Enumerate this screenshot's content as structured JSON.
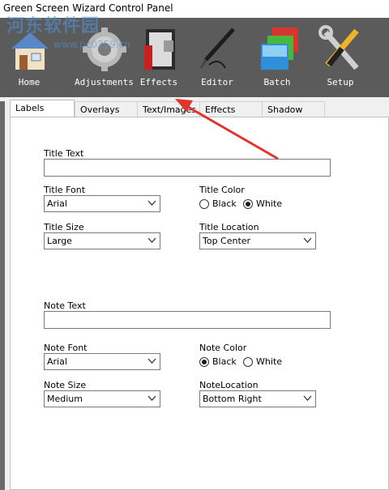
{
  "window": {
    "title": "Green Screen Wizard Control Panel"
  },
  "watermark": {
    "text": "河东软件园",
    "url": "www.pc0359.cn"
  },
  "toolbar": {
    "items": [
      {
        "label": "Home",
        "icon": "home-icon"
      },
      {
        "label": "Adjustments",
        "icon": "gear-icon"
      },
      {
        "label": "Effects",
        "icon": "effects-icon"
      },
      {
        "label": "Editor",
        "icon": "pen-icon"
      },
      {
        "label": "Batch",
        "icon": "stack-icon"
      },
      {
        "label": "Setup",
        "icon": "tools-icon"
      }
    ]
  },
  "tabs": [
    "Labels",
    "Overlays",
    "Text/Images",
    "Effects",
    "Shadow"
  ],
  "active_tab": "Labels",
  "form": {
    "title_text_label": "Title Text",
    "title_text_value": "",
    "title_font_label": "Title Font",
    "title_font_value": "Arial",
    "title_color_label": "Title Color",
    "title_color_options": [
      "Black",
      "White"
    ],
    "title_color_selected": "White",
    "title_size_label": "Title Size",
    "title_size_value": "Large",
    "title_location_label": "Title Location",
    "title_location_value": "Top Center",
    "note_text_label": "Note Text",
    "note_text_value": "",
    "note_font_label": "Note Font",
    "note_font_value": "Arial",
    "note_color_label": "Note Color",
    "note_color_options": [
      "Black",
      "White"
    ],
    "note_color_selected": "Black",
    "note_size_label": "Note Size",
    "note_size_value": "Medium",
    "note_location_label": "NoteLocation",
    "note_location_value": "Bottom Right"
  },
  "colors": {
    "toolbar_bg": "#5b5b5b",
    "annotation_arrow": "#e0352b"
  }
}
